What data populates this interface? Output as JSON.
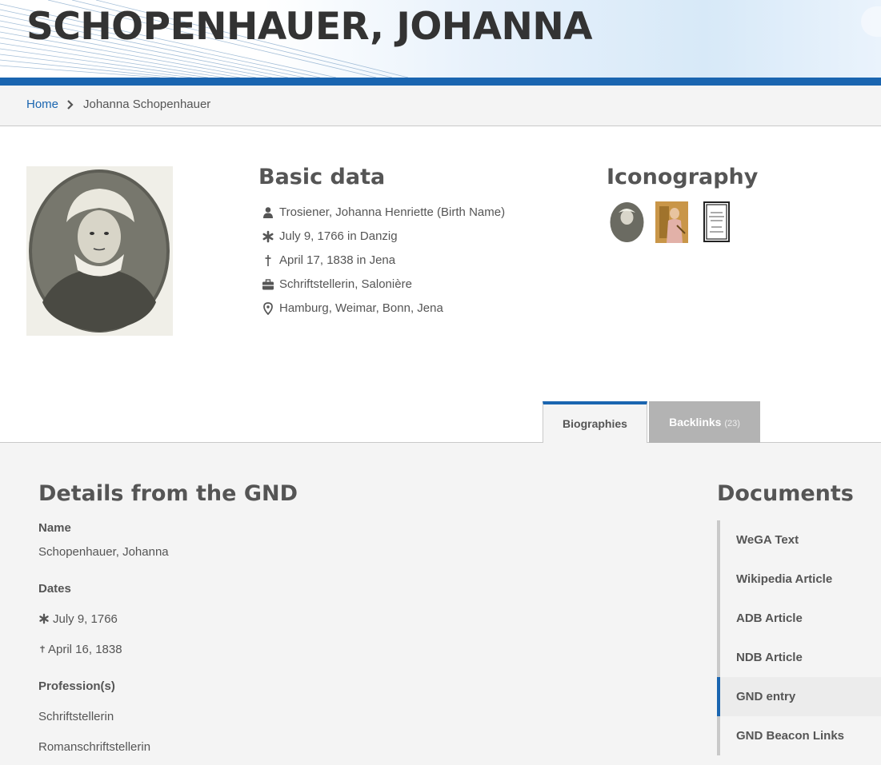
{
  "header": {
    "title": "SCHOPENHAUER, JOHANNA"
  },
  "breadcrumb": {
    "home": "Home",
    "current": "Johanna Schopenhauer"
  },
  "basic_data": {
    "title": "Basic data",
    "facts": [
      {
        "icon": "user-icon",
        "text": "Trosiener, Johanna Henriette (Birth Name)"
      },
      {
        "icon": "asterisk-icon",
        "text": "July 9, 1766 in Danzig"
      },
      {
        "icon": "dagger-icon",
        "text": "April 17, 1838 in Jena"
      },
      {
        "icon": "briefcase-icon",
        "text": "Schriftstellerin, Salonière"
      },
      {
        "icon": "map-marker-icon",
        "text": "Hamburg, Weimar, Bonn, Jena"
      }
    ]
  },
  "iconography": {
    "title": "Iconography"
  },
  "tabs": {
    "biographies": "Biographies",
    "backlinks": "Backlinks",
    "backlinks_count": "(23)"
  },
  "gnd": {
    "title": "Details from the GND",
    "name_label": "Name",
    "name_value": "Schopenhauer, Johanna",
    "dates_label": "Dates",
    "birth": "July 9, 1766",
    "death": "April 16, 1838",
    "professions_label": "Profession(s)",
    "professions": [
      "Schriftstellerin",
      "Romanschriftstellerin"
    ]
  },
  "documents": {
    "title": "Documents",
    "items": [
      "WeGA Text",
      "Wikipedia Article",
      "ADB Article",
      "NDB Article",
      "GND entry",
      "GND Beacon Links"
    ],
    "active_index": 4
  },
  "colors": {
    "accent": "#1a65b0",
    "text": "#555555",
    "panel": "#f4f4f4",
    "tab_inactive": "#b3b3b3"
  }
}
